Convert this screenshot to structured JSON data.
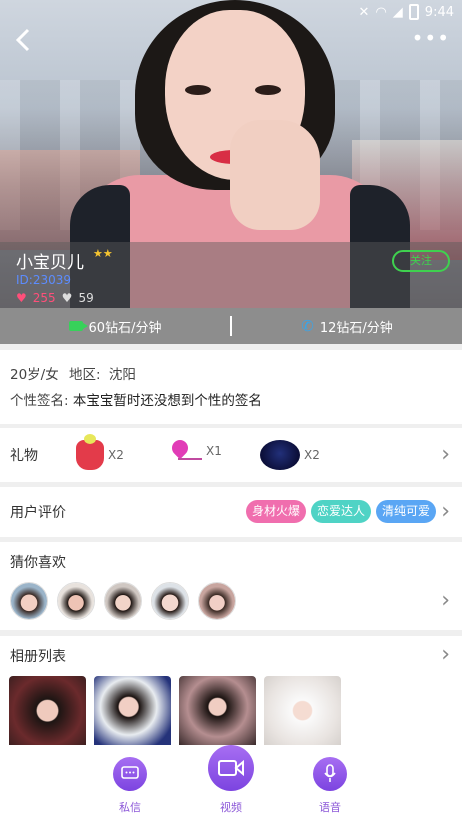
{
  "status_bar": {
    "time": "9:44"
  },
  "profile": {
    "nickname": "小宝贝儿",
    "level_stars": "★★",
    "id": "ID:23039",
    "likes": "255",
    "dislikes": "59",
    "follow_label": "关注"
  },
  "pricing": {
    "video": "60钻石/分钟",
    "voice": "12钻石/分钟"
  },
  "info": {
    "age_gender": "20岁/女",
    "region_label": "地区:",
    "region": "沈阳",
    "signature_label": "个性签名:",
    "signature": "本宝宝暂时还没想到个性的签名"
  },
  "gifts": {
    "label": "礼物",
    "items": [
      {
        "name": "cocktail",
        "count": "X2"
      },
      {
        "name": "heart-arrow",
        "count": "X1"
      },
      {
        "name": "blue-rose",
        "count": "X2"
      }
    ]
  },
  "reviews": {
    "label": "用户评价",
    "tags": [
      {
        "text": "身材火爆",
        "color": "#f06eae"
      },
      {
        "text": "恋爱达人",
        "color": "#4fd3c5"
      },
      {
        "text": "清纯可爱",
        "color": "#5aa6f4"
      }
    ]
  },
  "guess": {
    "label": "猜你喜欢"
  },
  "album": {
    "label": "相册列表"
  },
  "bottom_nav": {
    "message": "私信",
    "video": "视频",
    "voice": "语音"
  },
  "colors": {
    "accent": "#8c58d8",
    "green": "#3fd14f"
  }
}
